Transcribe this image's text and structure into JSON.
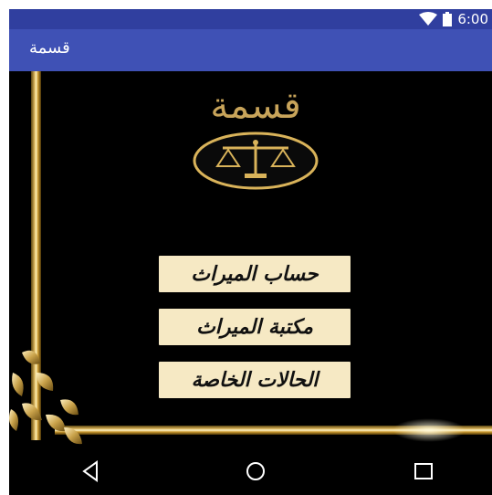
{
  "status_bar": {
    "time": "6:00"
  },
  "app_bar": {
    "title": "قسمة"
  },
  "content": {
    "logo_title": "قسمة",
    "buttons": {
      "inheritance_calc": "حساب الميراث",
      "inheritance_library": "مكتبة الميراث",
      "special_cases": "الحالات الخاصة"
    }
  },
  "icons": {
    "wifi": "wifi-icon",
    "battery": "battery-icon",
    "scales": "scales-icon",
    "back": "back-icon",
    "home": "home-icon",
    "recents": "recents-icon"
  },
  "colors": {
    "status_bar": "#303f9f",
    "app_bar": "#3f51b5",
    "gold": "#c8a45a",
    "button_bg": "#f6e9c4"
  }
}
